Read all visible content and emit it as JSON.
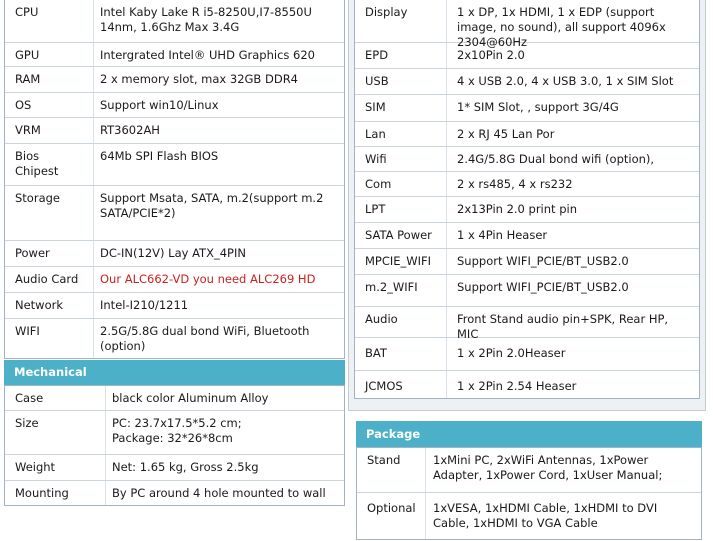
{
  "left_specs": [
    {
      "label": "CPU",
      "value": "Intel Kaby Lake R i5-8250U,I7-8550U 14nm, 1.6Ghz Max 3.4G"
    },
    {
      "label": "GPU",
      "value": "Intergrated Intel® UHD Graphics 620"
    },
    {
      "label": "RAM",
      "value": "2 x memory slot, max  32GB DDR4"
    },
    {
      "label": "OS",
      "value": "Support win10/Linux"
    },
    {
      "label": "VRM",
      "value": "RT3602AH"
    },
    {
      "label": "Bios Chipest",
      "value": "64Mb SPI Flash BIOS"
    },
    {
      "label": "Storage",
      "value": "Support  Msata, SATA,  m.2(support m.2 SATA/PCIE*2)"
    },
    {
      "label": "Power",
      "value": "DC-IN(12V) Lay ATX_4PIN"
    },
    {
      "label": "Audio Card",
      "value": "Our ALC662-VD  you need ALC269 HD"
    },
    {
      "label": "Network",
      "value": "Intel-I210/1211"
    },
    {
      "label": "WIFI",
      "value": "2.5G/5.8G dual bond WiFi, Bluetooth (option)"
    }
  ],
  "mechanical": {
    "title": "Mechanical",
    "rows": [
      {
        "label": "Case",
        "value": "black color Aluminum Alloy"
      },
      {
        "label": "Size",
        "value": "PC: 23.7x17.5*5.2 cm;\nPackage: 32*26*8cm"
      },
      {
        "label": "Weight",
        "value": "Net:  1.65 kg, Gross 2.5kg"
      },
      {
        "label": "Mounting",
        "value": "By PC around 4 hole mounted  to wall"
      }
    ]
  },
  "right_specs": [
    {
      "label": "Display",
      "value": "1 x DP, 1x HDMI, 1 x EDP (support  image, no sound), all support 4096x 2304@60Hz"
    },
    {
      "label": "EPD",
      "value": "2x10Pin 2.0"
    },
    {
      "label": "USB",
      "value": "4 x USB 2.0, 4 x  USB 3.0, 1 x SIM Slot"
    },
    {
      "label": "SIM",
      "value": "1* SIM Slot, , support 3G/4G"
    },
    {
      "label": "Lan",
      "value": "2 x RJ 45 Lan Por"
    },
    {
      "label": "Wifi",
      "value": "2.4G/5.8G Dual bond wifi (option),"
    },
    {
      "label": "Com",
      "value": "2 x rs485, 4 x rs232"
    },
    {
      "label": "LPT",
      "value": "2x13Pin 2.0 print  pin"
    },
    {
      "label": "SATA Power",
      "value": "1 x 4Pin Heaser"
    },
    {
      "label": "MPCIE_WIFI",
      "value": "Support WIFI_PCIE/BT_USB2.0"
    },
    {
      "label": "m.2_WIFI",
      "value": "Support WIFI_PCIE/BT_USB2.0"
    },
    {
      "label": "Audio",
      "value": "Front Stand audio pin+SPK, Rear HP,  MIC"
    },
    {
      "label": "BAT",
      "value": "1 x 2Pin 2.0Heaser"
    },
    {
      "label": "JCMOS",
      "value": "1 x 2Pin 2.54 Heaser"
    }
  ],
  "package": {
    "title": "Package",
    "rows": [
      {
        "label": "Stand",
        "value": "1xMini PC, 2xWiFi Antennas, 1xPower Adapter, 1xPower Cord, 1xUser Manual;"
      },
      {
        "label": "Optional",
        "value": "1xVESA,  1xHDMI Cable, 1xHDMI to DVI Cable, 1xHDMI to VGA Cable"
      }
    ]
  }
}
